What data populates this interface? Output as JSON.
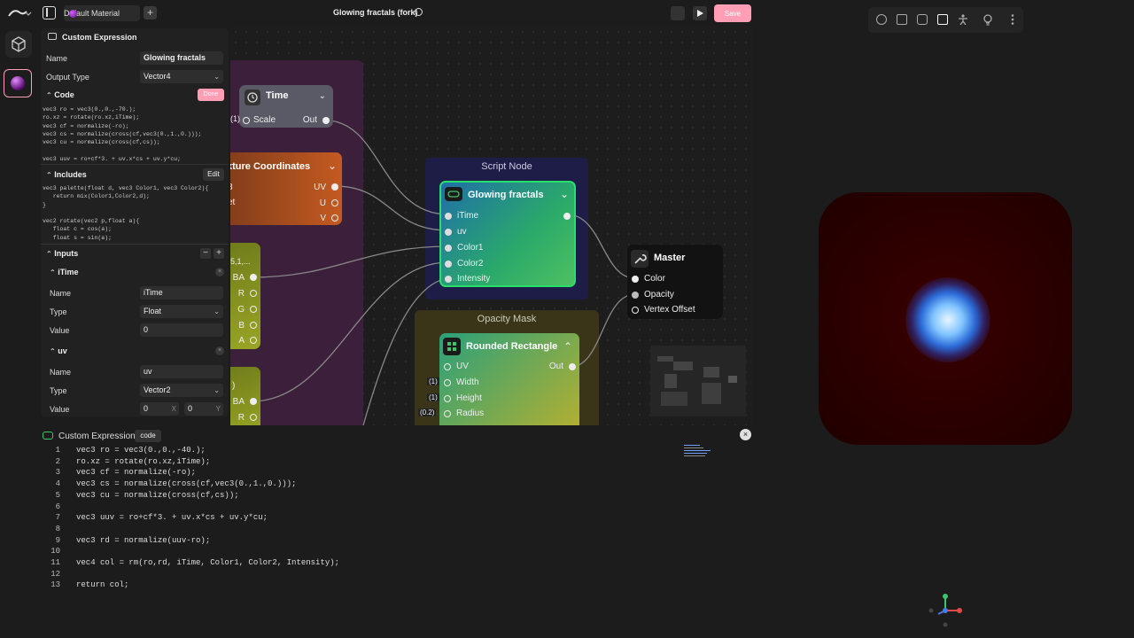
{
  "topbar": {
    "material_tab": "Default Material",
    "add_tab": "+",
    "title": "Glowing fractals (fork)",
    "save_label": "Save"
  },
  "panel": {
    "header": "Custom Expression",
    "name_label": "Name",
    "name_value": "Glowing fractals",
    "output_label": "Output Type",
    "output_value": "Vector4",
    "code_label": "Code",
    "done_label": "Done",
    "code_preview": "vec3 ro = vec3(0.,0.,-70.);\nro.xz = rotate(ro.xz,iTime);\nvec3 cf = normalize(-ro);\nvec3 cs = normalize(cross(cf,vec3(0.,1.,0.)));\nvec3 cu = normalize(cross(cf,cs));\n\nvec3 uuv = ro+cf*3. + uv.x*cs + uv.y*cu;",
    "includes_label": "Includes",
    "edit_label": "Edit",
    "includes_preview": "vec3 palette(float d, vec3 Color1, vec3 Color2){\n   return mix(Color1,Color2,d);\n}\n\nvec2 rotate(vec2 p,float a){\n   float c = cos(a);\n   float s = sin(a);",
    "inputs_label": "Inputs",
    "input1": {
      "title": "iTime",
      "name_label": "Name",
      "name": "iTime",
      "type_label": "Type",
      "type": "Float",
      "value_label": "Value",
      "value": "0"
    },
    "input2": {
      "title": "uv",
      "name_label": "Name",
      "name": "uv",
      "type_label": "Type",
      "type": "Vector2",
      "value_label": "Value",
      "value_x": "0",
      "x_label": "X",
      "value_y": "0",
      "y_label": "Y"
    }
  },
  "graph": {
    "script_group": "Script Node",
    "opacity_group": "Opacity Mask",
    "time_node": {
      "title": "Time",
      "scale": "Scale",
      "out": "Out",
      "marker": "(1)"
    },
    "tex_node": {
      "title": "xture Coordinates",
      "uv": "UV",
      "u": "U",
      "v": "V",
      "p1": "3",
      "p2": "et"
    },
    "rgba_node": {
      "top": "5,1,...",
      "rgba": "BA",
      "r": "R",
      "g": "G",
      "b": "B",
      "a": "A"
    },
    "rgba2_node": {
      "top": ")",
      "rgba": "BA",
      "r": "R"
    },
    "glow_node": {
      "title": "Glowing fractals",
      "p1": "iTime",
      "p2": "uv",
      "p3": "Color1",
      "p4": "Color2",
      "p5": "Intensity"
    },
    "master_node": {
      "title": "Master",
      "p1": "Color",
      "p2": "Opacity",
      "p3": "Vertex Offset"
    },
    "rr_node": {
      "title": "Rounded Rectangle",
      "p1": "UV",
      "p2": "Width",
      "p3": "Height",
      "p4": "Radius",
      "out": "Out",
      "m2": "(1)",
      "m3": "(1)",
      "m4": "(0.2)"
    }
  },
  "editor": {
    "title": "Custom Expression",
    "tag": "code",
    "close": "×",
    "lines": [
      {
        "n": "1",
        "t": "vec3 ro = vec3(0.,0.,-40.);"
      },
      {
        "n": "2",
        "t": "ro.xz = rotate(ro.xz,iTime);"
      },
      {
        "n": "3",
        "t": "vec3 cf = normalize(-ro);"
      },
      {
        "n": "4",
        "t": "vec3 cs = normalize(cross(cf,vec3(0.,1.,0.)));"
      },
      {
        "n": "5",
        "t": "vec3 cu = normalize(cross(cf,cs));"
      },
      {
        "n": "6",
        "t": ""
      },
      {
        "n": "7",
        "t": "vec3 uuv = ro+cf*3. + uv.x*cs + uv.y*cu;"
      },
      {
        "n": "8",
        "t": ""
      },
      {
        "n": "9",
        "t": "vec3 rd = normalize(uuv-ro);"
      },
      {
        "n": "10",
        "t": ""
      },
      {
        "n": "11",
        "t": "vec4 col = rm(ro,rd, iTime, Color1, Color2, Intensity);"
      },
      {
        "n": "12",
        "t": ""
      },
      {
        "n": "13",
        "t": "return col;"
      }
    ]
  },
  "colors": {
    "accent": "#ff9eb5",
    "node_selected": "#27e06a"
  }
}
